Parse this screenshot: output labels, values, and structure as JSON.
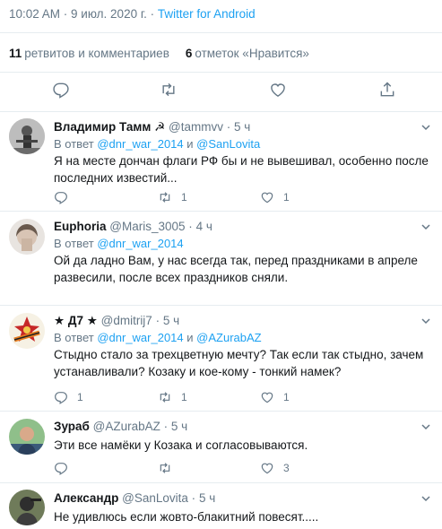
{
  "tweet_meta": {
    "time": "10:02 AM",
    "sep": " · ",
    "date": "9 июл. 2020 г.",
    "sep2": " · ",
    "source": "Twitter for Android"
  },
  "stats": {
    "retweets_count": "11",
    "retweets_label": "ретвитов и комментариев",
    "likes_count": "6",
    "likes_label": "отметок «Нравится»"
  },
  "replies": [
    {
      "name": "Владимир Тамм",
      "badge": "☭",
      "handle": "@tammvv",
      "time": "5 ч",
      "in_reply_prefix": "В ответ",
      "mention1": "@dnr_war_2014",
      "and": " и ",
      "mention2": "@SanLovita",
      "text": "Я на месте дончан флаги РФ бы и не вывешивал, особенно после последних известий...",
      "retweets": "1",
      "likes": "1"
    },
    {
      "name": "Euphoria",
      "handle": "@Maris_3005",
      "time": "4 ч",
      "in_reply_prefix": "В ответ",
      "mention1": "@dnr_war_2014",
      "text": "Ой да ладно Вам, у нас всегда так, перед праздниками в апреле развесили, после всех праздников сняли."
    },
    {
      "name": "★ Д7 ★",
      "handle": "@dmitrij7",
      "time": "5 ч",
      "in_reply_prefix": "В ответ",
      "mention1": "@dnr_war_2014",
      "and": " и ",
      "mention2": "@AZurabAZ",
      "text": "Стыдно стало за трехцветную мечту? Так если так стыдно, зачем устанавливали?  Козаку и кое-кому - тонкий намек?",
      "replies": "1",
      "retweets": "1",
      "likes": "1"
    },
    {
      "name": "Зураб",
      "handle": "@AZurabAZ",
      "time": "5 ч",
      "text": "Эти все намёки у Козака и согласовываются.",
      "likes": "3"
    },
    {
      "name": "Александр",
      "handle": "@SanLovita",
      "time": "5 ч",
      "text": "Не удивлюсь если жовто-блакитний повесят....."
    }
  ],
  "colors": {
    "accent": "#1da1f2",
    "muted": "#657786",
    "border": "#e6ecf0",
    "text": "#14171a"
  },
  "icons": [
    "reply-icon",
    "retweet-icon",
    "like-icon",
    "share-icon",
    "chevron-down-icon"
  ]
}
